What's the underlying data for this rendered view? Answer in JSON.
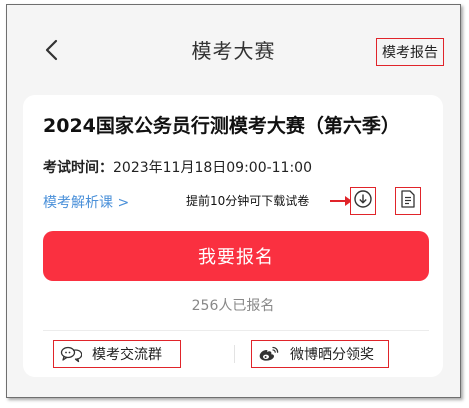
{
  "nav": {
    "title": "模考大赛",
    "report_label": "模考报告",
    "icons": {
      "back": "chevron-left-icon"
    }
  },
  "contest": {
    "title": "2024国家公务员行测模考大赛（第六季）",
    "time_label": "考试时间：",
    "time_value": "2023年11月18日09:00-11:00",
    "analysis_link": "模考解析课 >",
    "download_hint": "提前10分钟可下载试卷",
    "signup_label": "我要报名",
    "signup_count": "256人已报名"
  },
  "actions": {
    "group_label": "模考交流群",
    "weibo_label": "微博晒分领奖"
  },
  "icons": {
    "download": "download-icon",
    "document": "document-icon",
    "chat": "chat-bubbles-icon",
    "weibo": "weibo-icon"
  },
  "colors": {
    "accent": "#fa3040",
    "annotation": "#e0242a",
    "link": "#4a90d9",
    "background": "#f5f5f5"
  }
}
